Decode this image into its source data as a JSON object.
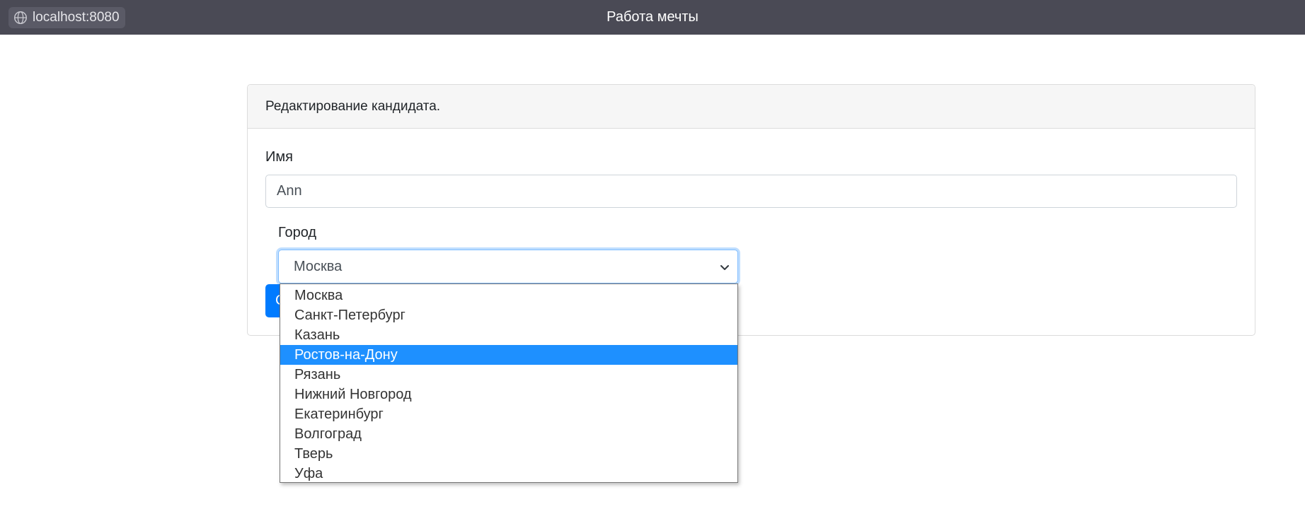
{
  "browser": {
    "origin": "localhost:8080"
  },
  "app": {
    "title": "Работа мечты"
  },
  "card": {
    "header": "Редактирование кандидата.",
    "name_label": "Имя",
    "name_value": "Ann",
    "city_label": "Город",
    "city_selected": "Москва",
    "save_label": "С"
  },
  "dropdown": {
    "highlighted_index": 3,
    "options": [
      "Москва",
      "Санкт-Петербург",
      "Казань",
      "Ростов-на-Дону",
      "Рязань",
      "Нижний Новгород",
      "Екатеринбург",
      "Волгоград",
      "Тверь",
      "Уфа"
    ]
  },
  "colors": {
    "topbar": "#4a4a55",
    "primary": "#007bff",
    "option_highlight": "#1e90ff"
  }
}
